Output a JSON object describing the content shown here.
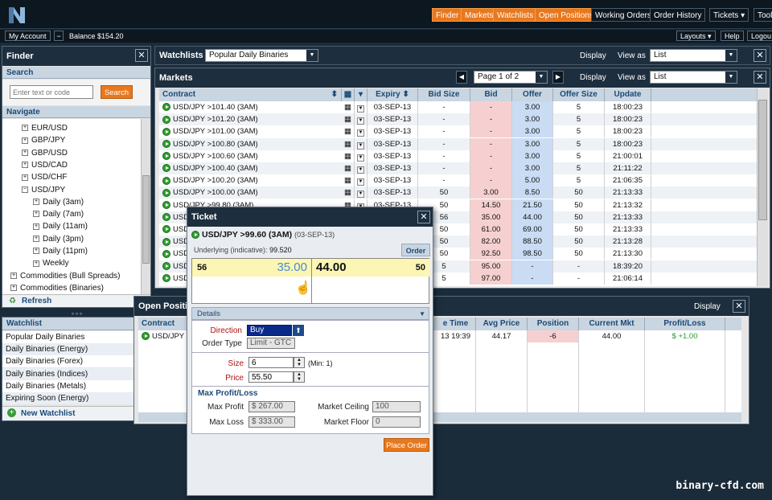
{
  "nav": {
    "items": [
      "Finder",
      "Markets",
      "Watchlists",
      "Open Positions",
      "Working Orders",
      "Order History",
      "Tickets ▾",
      "Tool"
    ]
  },
  "account": {
    "my_account": "My Account",
    "collapse": "−",
    "balance": "Balance $154.20",
    "layouts": "Layouts ▾",
    "help": "Help",
    "logout": "Logou"
  },
  "finder": {
    "title": "Finder",
    "search_head": "Search",
    "search_placeholder": "Enter text or code",
    "search_btn": "Search",
    "navigate_head": "Navigate",
    "refresh": "Refresh",
    "tree": [
      {
        "t": "EUR/USD",
        "lvl": 1,
        "sign": "+"
      },
      {
        "t": "GBP/JPY",
        "lvl": 1,
        "sign": "+"
      },
      {
        "t": "GBP/USD",
        "lvl": 1,
        "sign": "+"
      },
      {
        "t": "USD/CAD",
        "lvl": 1,
        "sign": "+"
      },
      {
        "t": "USD/CHF",
        "lvl": 1,
        "sign": "+"
      },
      {
        "t": "USD/JPY",
        "lvl": 1,
        "sign": "−"
      },
      {
        "t": "Daily (3am)",
        "lvl": 2,
        "sign": "+"
      },
      {
        "t": "Daily (7am)",
        "lvl": 2,
        "sign": "+"
      },
      {
        "t": "Daily (11am)",
        "lvl": 2,
        "sign": "+"
      },
      {
        "t": "Daily (3pm)",
        "lvl": 2,
        "sign": "+"
      },
      {
        "t": "Daily (11pm)",
        "lvl": 2,
        "sign": "+"
      },
      {
        "t": "Weekly",
        "lvl": 2,
        "sign": "+"
      },
      {
        "t": "Commodities (Bull Spreads)",
        "lvl": 0,
        "sign": "+"
      },
      {
        "t": "Commodities (Binaries)",
        "lvl": 0,
        "sign": "+"
      }
    ]
  },
  "watchlist_panel": {
    "title": "Watchlist",
    "items": [
      "Popular Daily Binaries",
      "Daily Binaries (Energy)",
      "Daily Binaries (Forex)",
      "Daily Binaries (Indices)",
      "Daily Binaries (Metals)",
      "Expiring Soon (Energy)"
    ],
    "new": "New Watchlist"
  },
  "watchlists": {
    "title": "Watchlists",
    "selected": "Popular Daily Binaries",
    "display": "Display",
    "view_as": "View as",
    "view_val": "List"
  },
  "markets": {
    "title": "Markets",
    "page": "Page 1 of 2",
    "display": "Display",
    "view_as": "View as",
    "view_val": "List",
    "headers": [
      "Contract",
      "Expiry",
      "Bid Size",
      "Bid",
      "Offer",
      "Offer Size",
      "Update"
    ],
    "rows": [
      [
        "USD/JPY >101.40 (3AM)",
        "03-SEP-13",
        "-",
        "-",
        "3.00",
        "5",
        "18:00:23"
      ],
      [
        "USD/JPY >101.20 (3AM)",
        "03-SEP-13",
        "-",
        "-",
        "3.00",
        "5",
        "18:00:23"
      ],
      [
        "USD/JPY >101.00 (3AM)",
        "03-SEP-13",
        "-",
        "-",
        "3.00",
        "5",
        "18:00:23"
      ],
      [
        "USD/JPY >100.80 (3AM)",
        "03-SEP-13",
        "-",
        "-",
        "3.00",
        "5",
        "18:00:23"
      ],
      [
        "USD/JPY >100.60 (3AM)",
        "03-SEP-13",
        "-",
        "-",
        "3.00",
        "5",
        "21:00:01"
      ],
      [
        "USD/JPY >100.40 (3AM)",
        "03-SEP-13",
        "-",
        "-",
        "3.00",
        "5",
        "21:11:22"
      ],
      [
        "USD/JPY >100.20 (3AM)",
        "03-SEP-13",
        "-",
        "-",
        "5.00",
        "5",
        "21:06:35"
      ],
      [
        "USD/JPY >100.00 (3AM)",
        "03-SEP-13",
        "50",
        "3.00",
        "8.50",
        "50",
        "21:13:33"
      ],
      [
        "USD/JPY >99.80 (3AM)",
        "03-SEP-13",
        "50",
        "14.50",
        "21.50",
        "50",
        "21:13:32"
      ],
      [
        "USD/JPY >99.60 (3AM)",
        "03-SEP-13",
        "56",
        "35.00",
        "44.00",
        "50",
        "21:13:33"
      ],
      [
        "USD/JPY >99.40 (3AM)",
        "03-SEP-13",
        "50",
        "61.00",
        "69.00",
        "50",
        "21:13:33"
      ],
      [
        "USD/JPY >99.20 (3AM)",
        "03-SEP-13",
        "50",
        "82.00",
        "88.50",
        "50",
        "21:13:28"
      ],
      [
        "USD/JPY >99.00 (3AM)",
        "03-SEP-13",
        "50",
        "92.50",
        "98.50",
        "50",
        "21:13:30"
      ],
      [
        "USD/JPY >98.80 (3AM)",
        "03-SEP-13",
        "5",
        "95.00",
        "-",
        "-",
        "18:39:20"
      ],
      [
        "USD/JPY >98.60 (3AM)",
        "03-SEP-13",
        "5",
        "97.00",
        "-",
        "-",
        "21:06:14"
      ]
    ]
  },
  "open_positions": {
    "title": "Open Positio",
    "display": "Display",
    "headers": [
      "Contract",
      "e Time",
      "Avg Price",
      "Position",
      "Current Mkt",
      "Profit/Loss"
    ],
    "row": {
      "contract": "USD/JPY >",
      "time": "13 19:39",
      "avg": "44.17",
      "pos": "-6",
      "mkt": "44.00",
      "pl": "$ +1.00"
    }
  },
  "ticket": {
    "title": "Ticket",
    "contract": "USD/JPY >99.60 (3AM)",
    "expiry": "(03-SEP-13)",
    "underlying_label": "Underlying (indicative):",
    "underlying": "99.520",
    "order_tab": "Order",
    "bid_size": "56",
    "bid": "35.00",
    "offer": "44.00",
    "offer_size": "50",
    "details": "Details",
    "direction_label": "Direction",
    "direction": "Buy",
    "order_type_label": "Order Type",
    "order_type": "Limit - GTC",
    "size_label": "Size",
    "size": "6",
    "min": "(Min: 1)",
    "price_label": "Price",
    "price": "55.50",
    "maxpl_head": "Max Profit/Loss",
    "max_profit_label": "Max Profit",
    "max_profit": "$ 267.00",
    "max_loss_label": "Max Loss",
    "max_loss": "$ 333.00",
    "ceiling_label": "Market Ceiling",
    "ceiling": "100",
    "floor_label": "Market Floor",
    "floor": "0",
    "place": "Place Order"
  },
  "watermark": "binary-cfd.com",
  "colors": {
    "orange": "#e8781e",
    "dark": "#1d2f3f",
    "bid": "#f6d0d0",
    "offer": "#c9dcf4",
    "yellow": "#fbf6b4"
  }
}
